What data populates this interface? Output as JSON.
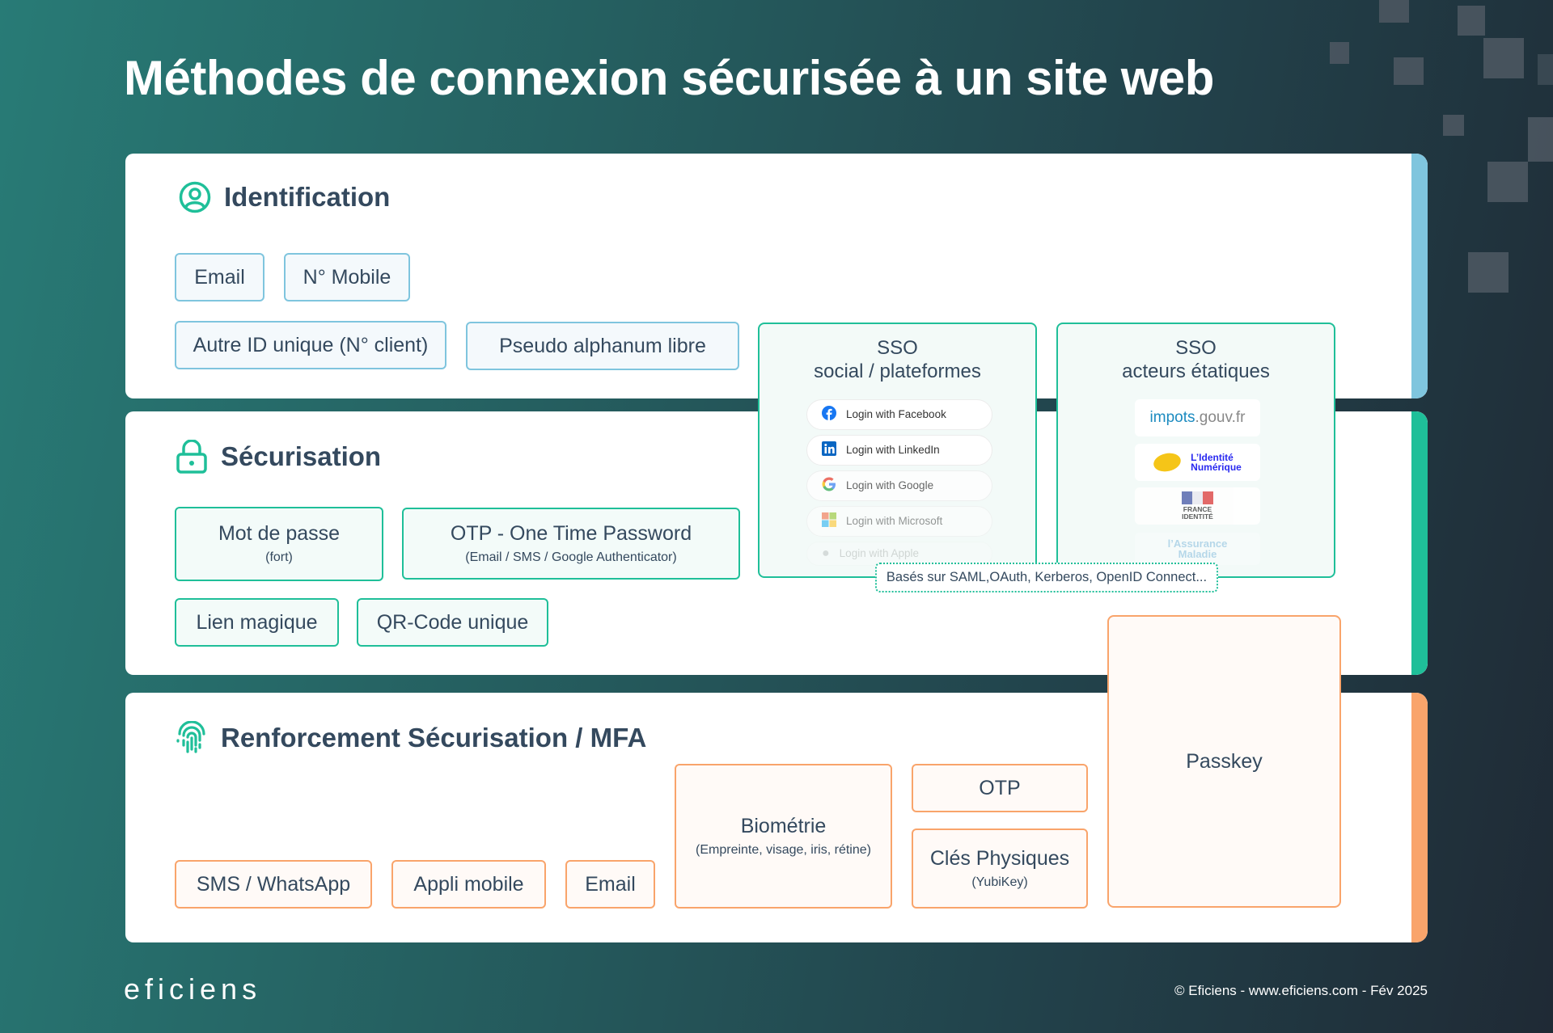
{
  "title": "Méthodes de connexion sécurisée à un site web",
  "colors": {
    "identification_accent": "#7fc5de",
    "securisation_accent": "#1fbf99",
    "mfa_accent": "#f9a46b",
    "text_dark": "#34495e",
    "icon_green": "#1fbf99"
  },
  "sections": {
    "identification": {
      "title": "Identification",
      "icon": "user-circle-icon",
      "items": [
        {
          "label": "Email"
        },
        {
          "label": "N° Mobile"
        },
        {
          "label": "Autre ID unique (N° client)"
        },
        {
          "label": "Pseudo alphanum libre"
        }
      ]
    },
    "securisation": {
      "title": "Sécurisation",
      "icon": "lock-icon",
      "items": [
        {
          "label": "Mot de passe",
          "sub": "(fort)"
        },
        {
          "label": "OTP - One Time Password",
          "sub": "(Email / SMS / Google Authenticator)"
        },
        {
          "label": "Lien magique"
        },
        {
          "label": "QR-Code unique"
        }
      ]
    },
    "mfa": {
      "title": "Renforcement Sécurisation / MFA",
      "icon": "fingerprint-icon",
      "items": [
        {
          "label": "SMS / WhatsApp"
        },
        {
          "label": "Appli mobile"
        },
        {
          "label": "Email"
        },
        {
          "label": "Biométrie",
          "sub": "(Empreinte, visage, iris, rétine)"
        },
        {
          "label": "OTP"
        },
        {
          "label": "Clés Physiques",
          "sub": "(YubiKey)"
        }
      ]
    }
  },
  "sso_social": {
    "title_line1": "SSO",
    "title_line2": "social / plateformes",
    "buttons": [
      {
        "label": "Login with Facebook",
        "icon": "facebook-icon"
      },
      {
        "label": "Login with LinkedIn",
        "icon": "linkedin-icon"
      },
      {
        "label": "Login with Google",
        "icon": "google-icon"
      },
      {
        "label": "Login with Microsoft",
        "icon": "microsoft-icon"
      },
      {
        "label": "Login with Apple",
        "icon": "apple-icon"
      }
    ]
  },
  "sso_etat": {
    "title_line1": "SSO",
    "title_line2": "acteurs étatiques",
    "logos": [
      {
        "part1": "impots",
        "part2": ".gouv.fr"
      },
      {
        "line1": "L’Identité",
        "line2": "Numérique"
      },
      {
        "line1": "FRANCE",
        "line2": "IDENTITÉ"
      },
      {
        "line1": "l’Assurance",
        "line2": "Maladie"
      }
    ]
  },
  "protocols_note": "Basés sur SAML,OAuth, Kerberos, OpenID Connect...",
  "passkey": "Passkey",
  "footer": {
    "logo": "eficiens",
    "copyright": "© Eficiens - www.eficiens.com - Fév 2025"
  }
}
